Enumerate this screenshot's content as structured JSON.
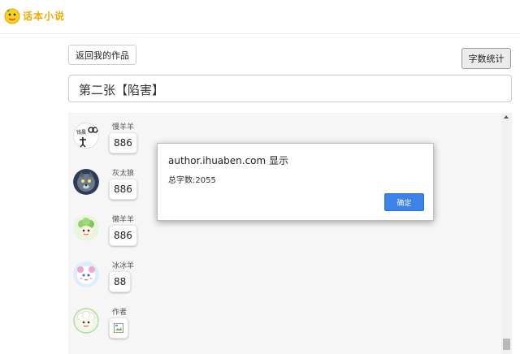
{
  "header": {
    "logo_text": "话本小说"
  },
  "toolbar": {
    "back_label": "返回我的作品",
    "count_label": "字数统计"
  },
  "chapter": {
    "title": "第二张【陷害】"
  },
  "messages": [
    {
      "name": "慢羊羊",
      "text": "886"
    },
    {
      "name": "灰太狼",
      "text": "886"
    },
    {
      "name": "懒羊羊",
      "text": "886"
    },
    {
      "name": "冰冰羊",
      "text": "88"
    },
    {
      "name": "作者",
      "text": ""
    }
  ],
  "avatar_icons": [
    "slow-sheep-avatar-icon",
    "grey-wolf-avatar-icon",
    "lazy-sheep-avatar-icon",
    "ice-sheep-avatar-icon",
    "author-avatar-icon"
  ],
  "dialog": {
    "title": "author.ihuaben.com 显示",
    "message": "总字数:2055",
    "ok_label": "确定"
  },
  "colors": {
    "accent": "#3c82e8",
    "logo": "#f2a900"
  }
}
